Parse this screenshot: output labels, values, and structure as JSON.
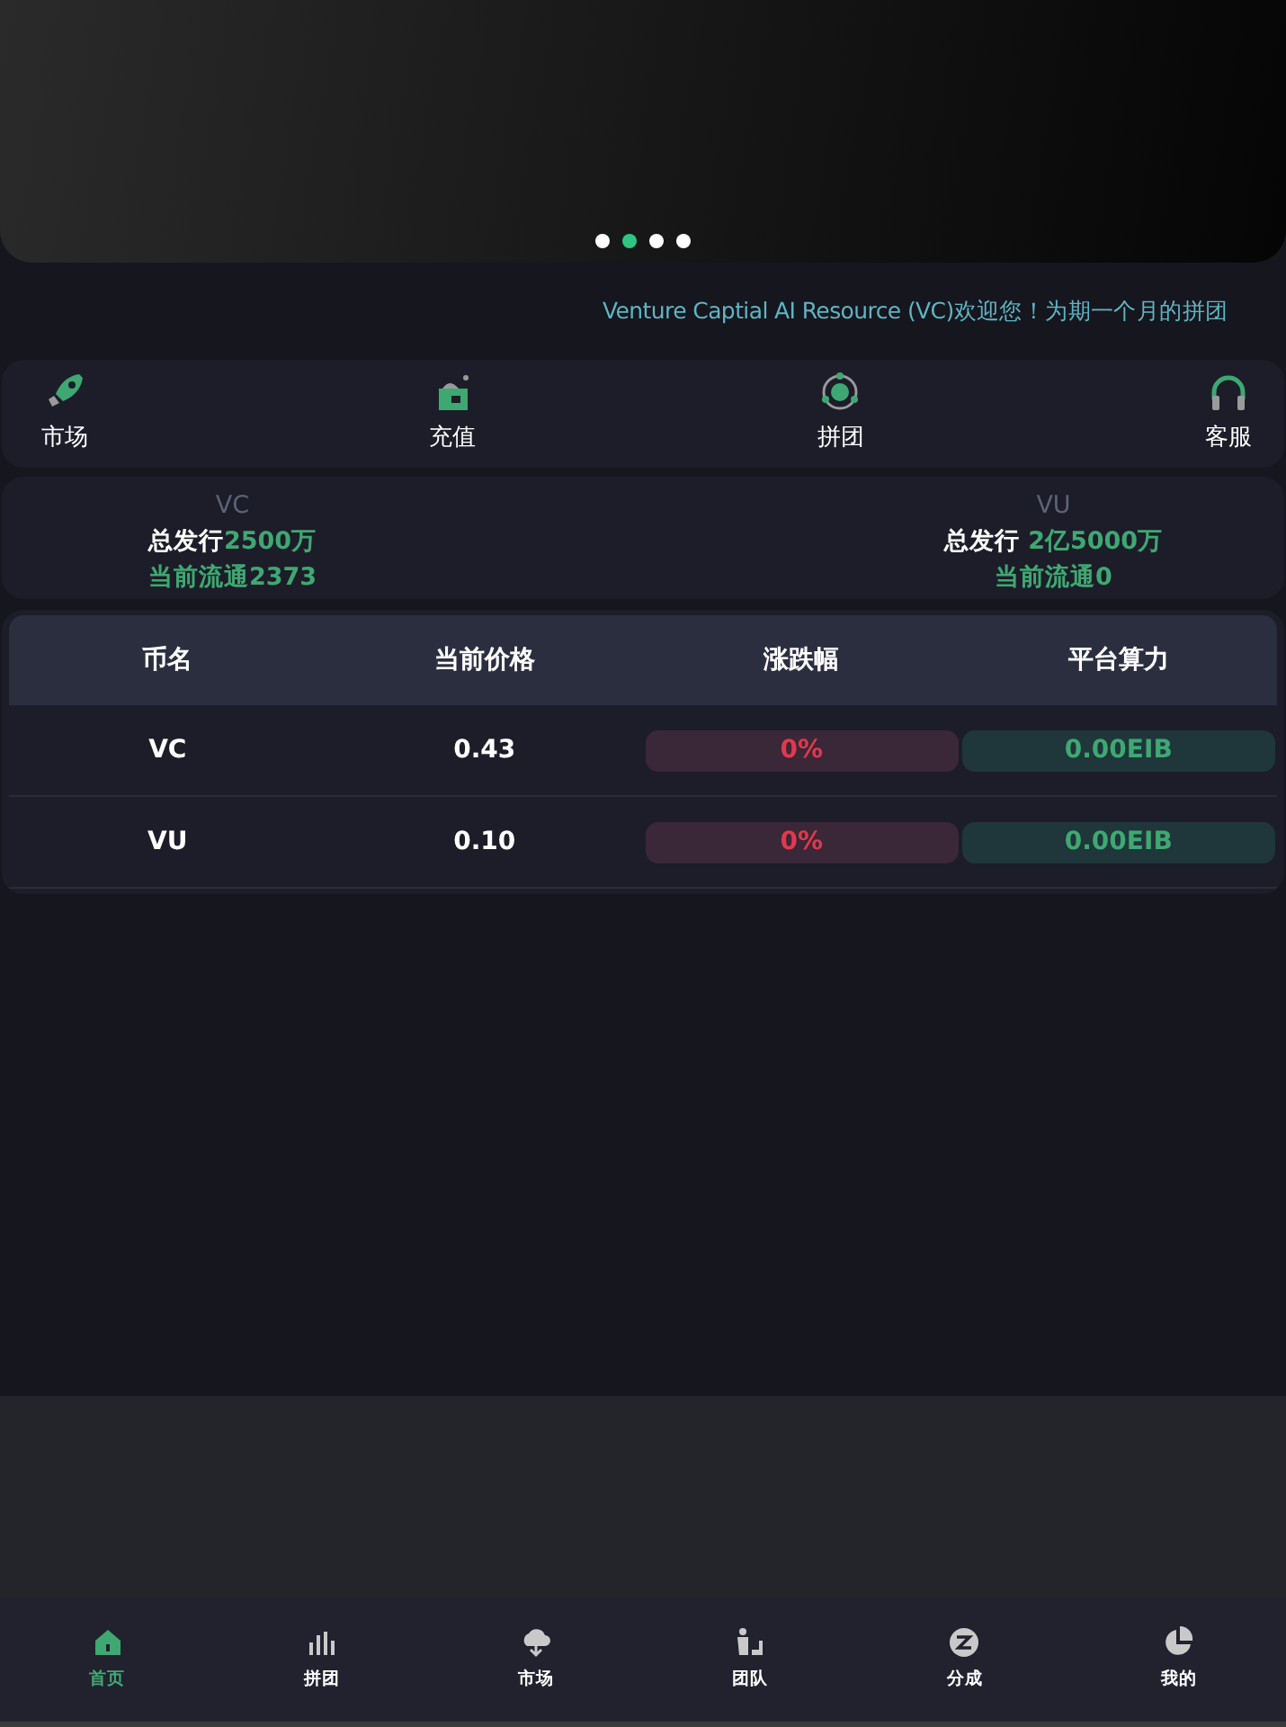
{
  "carousel": {
    "dots": [
      {
        "selected": false
      },
      {
        "selected": true
      },
      {
        "selected": false
      },
      {
        "selected": false
      }
    ]
  },
  "notice": "Venture Captial AI Resource (VC)欢迎您！为期一个月的拼团",
  "quick_menu": [
    {
      "label": "市场"
    },
    {
      "label": "充值"
    },
    {
      "label": "拼团"
    },
    {
      "label": "客服"
    }
  ],
  "supply": [
    {
      "coin": "VC",
      "total_label": "总发行",
      "total_value": "2500万",
      "circulating": "当前流通2373"
    },
    {
      "coin": "VU",
      "total_label": "总发行",
      "total_value": " 2亿5000万",
      "circulating": "当前流通0"
    }
  ],
  "table": {
    "columns": [
      "币名",
      "当前价格",
      "涨跌幅",
      "平台算力"
    ],
    "rows": [
      {
        "name": "VC",
        "price": "0.43",
        "change": "0%",
        "power": "0.00EIB"
      },
      {
        "name": "VU",
        "price": "0.10",
        "change": "0%",
        "power": "0.00EIB"
      }
    ]
  },
  "bottom_nav": [
    {
      "label": "首页",
      "selected": true
    },
    {
      "label": "拼团",
      "selected": false
    },
    {
      "label": "市场",
      "selected": false
    },
    {
      "label": "团队",
      "selected": false
    },
    {
      "label": "分成",
      "selected": false
    },
    {
      "label": "我的",
      "selected": false
    }
  ]
}
